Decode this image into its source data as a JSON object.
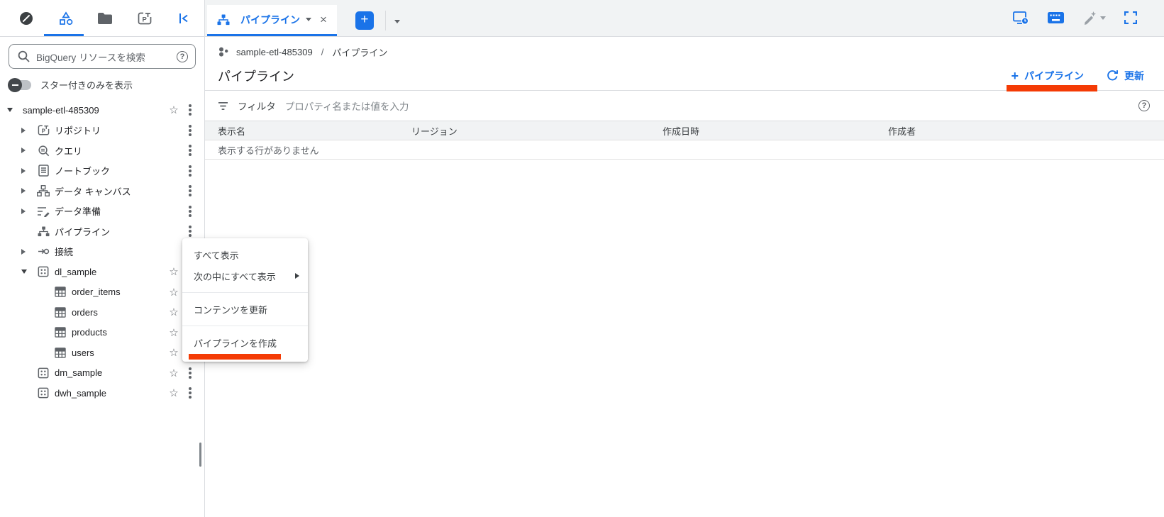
{
  "colors": {
    "accent": "#1a73e8",
    "annotation": "#f43b05",
    "icon_gray": "#5f6368"
  },
  "icons": {
    "star": "☆",
    "close": "×",
    "help": "?",
    "plus": "+"
  },
  "tabs": {
    "active": {
      "label": "パイプライン"
    }
  },
  "sidebar": {
    "search_placeholder": "BigQuery リソースを検索",
    "star_toggle_label": "スター付きのみを表示",
    "tree": [
      {
        "label": "sample-etl-485309"
      },
      {
        "label": "リポジトリ"
      },
      {
        "label": "クエリ"
      },
      {
        "label": "ノートブック"
      },
      {
        "label": "データ キャンバス"
      },
      {
        "label": "データ準備"
      },
      {
        "label": "パイプライン"
      },
      {
        "label": "接続"
      },
      {
        "label": "dl_sample"
      },
      {
        "label": "order_items"
      },
      {
        "label": "orders"
      },
      {
        "label": "products"
      },
      {
        "label": "users"
      },
      {
        "label": "dm_sample"
      },
      {
        "label": "dwh_sample"
      }
    ]
  },
  "context_menu": {
    "items": [
      {
        "label": "すべて表示"
      },
      {
        "label": "次の中にすべて表示",
        "has_submenu": true
      },
      {
        "label": "コンテンツを更新"
      },
      {
        "label": "パイプラインを作成",
        "annotated": true
      }
    ]
  },
  "main": {
    "breadcrumb": {
      "project": "sample-etl-485309",
      "separator": "/",
      "page": "パイプライン"
    },
    "title": "パイプライン",
    "actions": {
      "create": "パイプライン",
      "refresh": "更新"
    },
    "filter": {
      "label": "フィルタ",
      "placeholder": "プロパティ名または値を入力"
    },
    "table": {
      "headers": [
        "表示名",
        "リージョン",
        "作成日時",
        "作成者"
      ],
      "empty": "表示する行がありません"
    }
  }
}
